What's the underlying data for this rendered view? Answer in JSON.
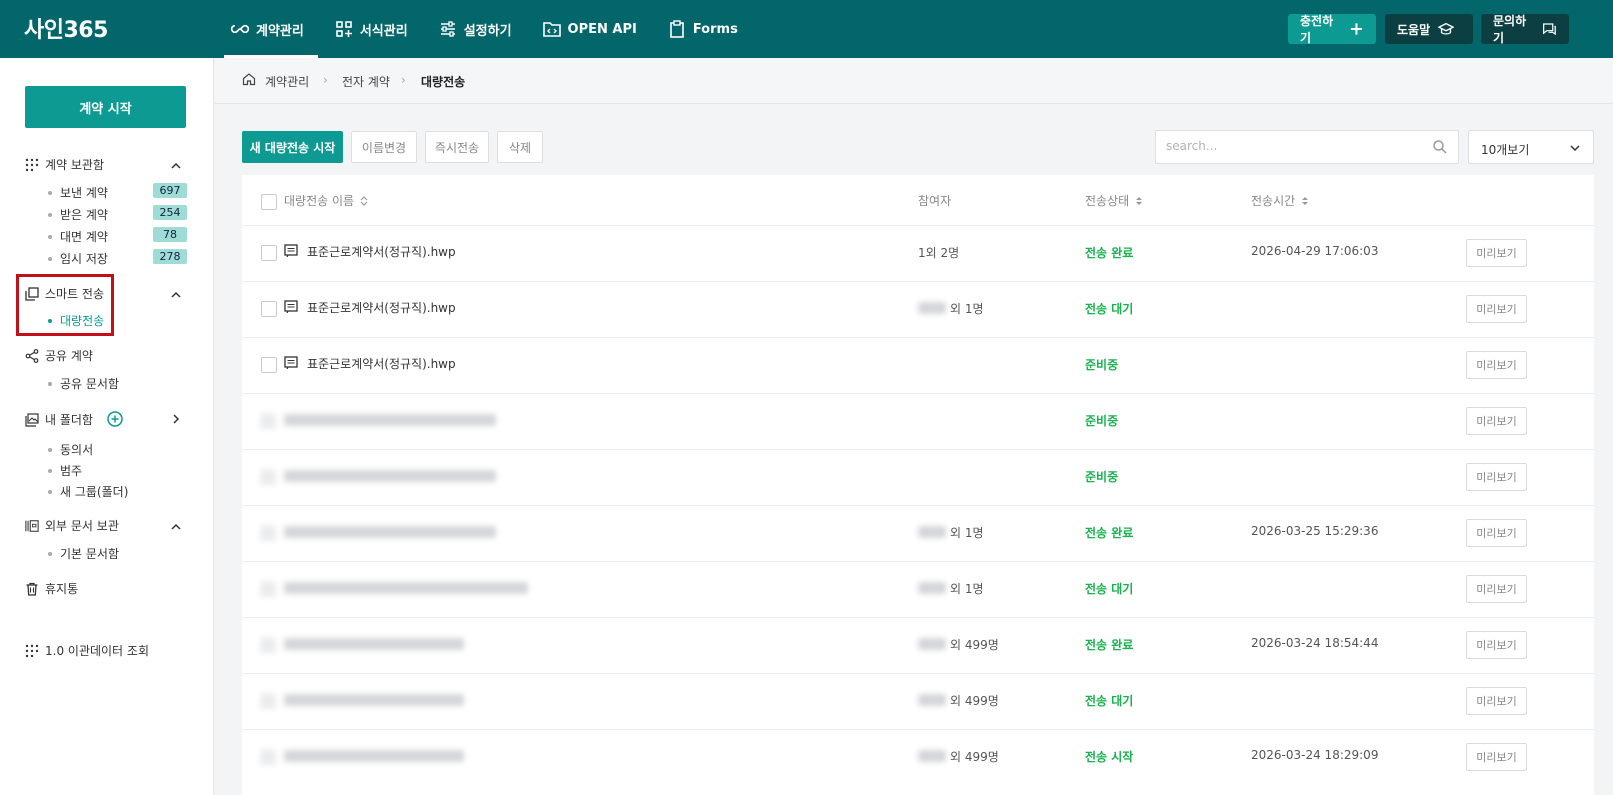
{
  "app": {
    "logo": "사인365"
  },
  "nav": [
    {
      "label": "계약관리",
      "icon": "infinity-icon"
    },
    {
      "label": "서식관리",
      "icon": "grid-plus-icon"
    },
    {
      "label": "설정하기",
      "icon": "sliders-icon"
    },
    {
      "label": "OPEN API",
      "icon": "folder-code-icon"
    },
    {
      "label": "Forms",
      "icon": "clipboard-icon"
    }
  ],
  "top_buttons": {
    "charge": "충전하기",
    "help": "도움말",
    "inquiry": "문의하기"
  },
  "sidebar": {
    "start_button": "계약 시작",
    "storage": {
      "title": "계약 보관함",
      "items": [
        {
          "label": "보낸 계약",
          "count": "697"
        },
        {
          "label": "받은 계약",
          "count": "254"
        },
        {
          "label": "대면 계약",
          "count": "78"
        },
        {
          "label": "임시 저장",
          "count": "278"
        }
      ]
    },
    "smart": {
      "title": "스마트 전송",
      "items": [
        {
          "label": "대량전송"
        }
      ]
    },
    "shared": {
      "title": "공유 계약",
      "items": [
        {
          "label": "공유 문서함"
        }
      ]
    },
    "folders": {
      "title": "내 폴더함",
      "items": [
        {
          "label": "동의서"
        },
        {
          "label": "범주"
        },
        {
          "label": "새 그룹(폴더)"
        }
      ]
    },
    "external": {
      "title": "외부 문서 보관",
      "items": [
        {
          "label": "기본 문서함"
        }
      ]
    },
    "trash": "휴지통",
    "legacy": "1.0 이관데이터 조회"
  },
  "breadcrumb": [
    "계약관리",
    "전자 계약",
    "대량전송"
  ],
  "toolbar": {
    "new": "새 대량전송 시작",
    "rename": "이름변경",
    "send_now": "즉시전송",
    "delete": "삭제",
    "search_placeholder": "search...",
    "page_size": "10개보기"
  },
  "table": {
    "headers": {
      "name": "대량전송 이름",
      "participants": "참여자",
      "status": "전송상태",
      "time": "전송시간"
    },
    "preview_label": "미리보기",
    "rows": [
      {
        "name": "표준근로계약서(정규직).hwp",
        "participants": "1외 2명",
        "status": "전송 완료",
        "time": "2026-04-29 17:06:03"
      },
      {
        "name": "표준근로계약서(정규직).hwp",
        "participants": "외 1명",
        "status": "전송 대기",
        "time": ""
      },
      {
        "name": "표준근로계약서(정규직).hwp",
        "participants": "",
        "status": "준비중",
        "time": ""
      },
      {
        "name": "",
        "participants": "",
        "status": "준비중",
        "time": ""
      },
      {
        "name": "",
        "participants": "",
        "status": "준비중",
        "time": ""
      },
      {
        "name": "",
        "participants": "외 1명",
        "status": "전송 완료",
        "time": "2026-03-25 15:29:36"
      },
      {
        "name": "",
        "participants": "외 1명",
        "status": "전송 대기",
        "time": ""
      },
      {
        "name": "",
        "participants": "외 499명",
        "status": "전송 완료",
        "time": "2026-03-24 18:54:44"
      },
      {
        "name": "",
        "participants": "외 499명",
        "status": "전송 대기",
        "time": ""
      },
      {
        "name": "",
        "participants": "외 499명",
        "status": "전송 시작",
        "time": "2026-03-24 18:29:09"
      }
    ]
  }
}
